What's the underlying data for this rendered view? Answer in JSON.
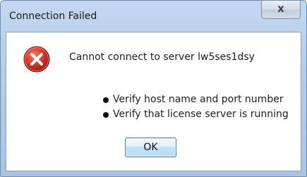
{
  "window": {
    "title": "Connection Failed",
    "close_glyph": "x"
  },
  "dialog": {
    "icon": "error-icon",
    "message": "Cannot connect to server lw5ses1dsy",
    "bullets": [
      "Verify host name and port number",
      "Verify that license server is running"
    ],
    "ok_label": "OK"
  },
  "colors": {
    "titlebar": "#b6cde8",
    "error_red": "#c4251b",
    "ok_button_border": "#3c7fb1"
  }
}
